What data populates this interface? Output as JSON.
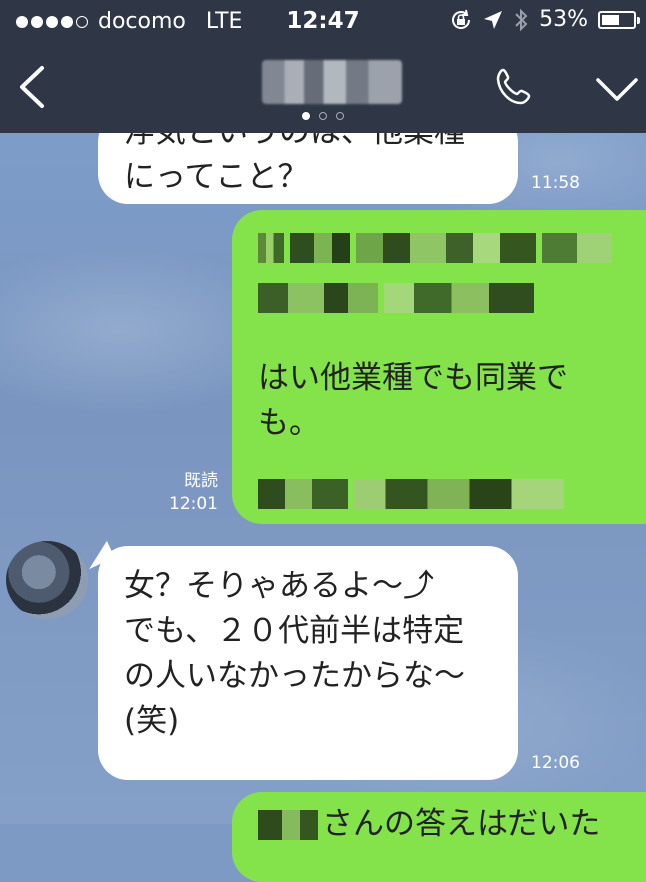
{
  "status_bar": {
    "carrier": "docomo",
    "network": "LTE",
    "time": "12:47",
    "battery": "53%"
  },
  "header": {
    "back_icon": "chevron-left-icon",
    "call_icon": "phone-icon",
    "menu_icon": "chevron-down-icon"
  },
  "messages": [
    {
      "side": "left",
      "lines": [
        "浮気というのは、他業種",
        "にってこと？"
      ],
      "time": "11:58"
    },
    {
      "side": "right",
      "lines": [
        "はい他業種でも同業で",
        "も。"
      ],
      "read": "既読",
      "time": "12:01"
    },
    {
      "side": "left",
      "lines": [
        "女？そりゃあるよ〜⤴",
        "でも、２０代前半は特定",
        "の人いなかったからな〜",
        "(笑)"
      ],
      "time": "12:06"
    },
    {
      "side": "right",
      "lines": [
        "さんの答えはだいた"
      ]
    }
  ],
  "colors": {
    "header_bg": "#2f3747",
    "chat_bg": "#7d9ac4",
    "sent_bubble": "#84e34a",
    "received_bubble": "#ffffff"
  }
}
